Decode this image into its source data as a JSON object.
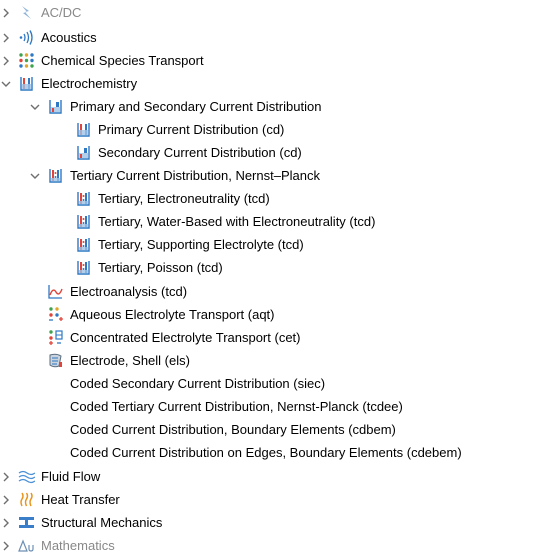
{
  "tree": {
    "ac_dc": "AC/DC",
    "acoustics": "Acoustics",
    "chemical_species_transport": "Chemical Species Transport",
    "electrochemistry": "Electrochemistry",
    "primary_secondary": "Primary and Secondary Current Distribution",
    "primary_cd": "Primary Current Distribution (cd)",
    "secondary_cd": "Secondary Current Distribution (cd)",
    "tertiary_np": "Tertiary Current Distribution, Nernst–Planck",
    "tertiary_electroneutrality": "Tertiary, Electroneutrality (tcd)",
    "tertiary_water_based": "Tertiary, Water-Based with Electroneutrality (tcd)",
    "tertiary_supporting": "Tertiary, Supporting Electrolyte (tcd)",
    "tertiary_poisson": "Tertiary, Poisson (tcd)",
    "electroanalysis": "Electroanalysis (tcd)",
    "aqueous_transport": "Aqueous Electrolyte Transport (aqt)",
    "concentrated_transport": "Concentrated Electrolyte Transport (cet)",
    "electrode_shell": "Electrode, Shell (els)",
    "coded_secondary": "Coded Secondary Current Distribution (siec)",
    "coded_tertiary": "Coded Tertiary Current Distribution, Nernst-Planck (tcdee)",
    "coded_boundary": "Coded Current Distribution, Boundary Elements (cdbem)",
    "coded_edges": "Coded Current Distribution on Edges, Boundary Elements (cdebem)",
    "fluid_flow": "Fluid Flow",
    "heat_transfer": "Heat Transfer",
    "structural_mechanics": "Structural Mechanics",
    "mathematics": "Mathematics"
  },
  "icons": {
    "ac_dc": "lightning-icon",
    "acoustics": "sound-wave-icon",
    "chemical_species_transport": "species-dots-icon",
    "electrochemistry": "beaker-icon",
    "current_distribution": "beaker-icon",
    "tertiary": "tertiary-beaker-icon",
    "electroanalysis": "electroanalysis-curve-icon",
    "electrolyte_transport": "electrolyte-transport-icon",
    "electrode_shell": "electrode-shell-icon",
    "fluid_flow": "flow-waves-icon",
    "heat_transfer": "heat-icon",
    "structural_mechanics": "beam-icon",
    "mathematics": "delta-u-icon"
  },
  "colors": {
    "chevron": "#6e6e6e",
    "beaker_red": "#e0443a",
    "beaker_blue": "#2f78c4",
    "faded_text": "#888888"
  }
}
